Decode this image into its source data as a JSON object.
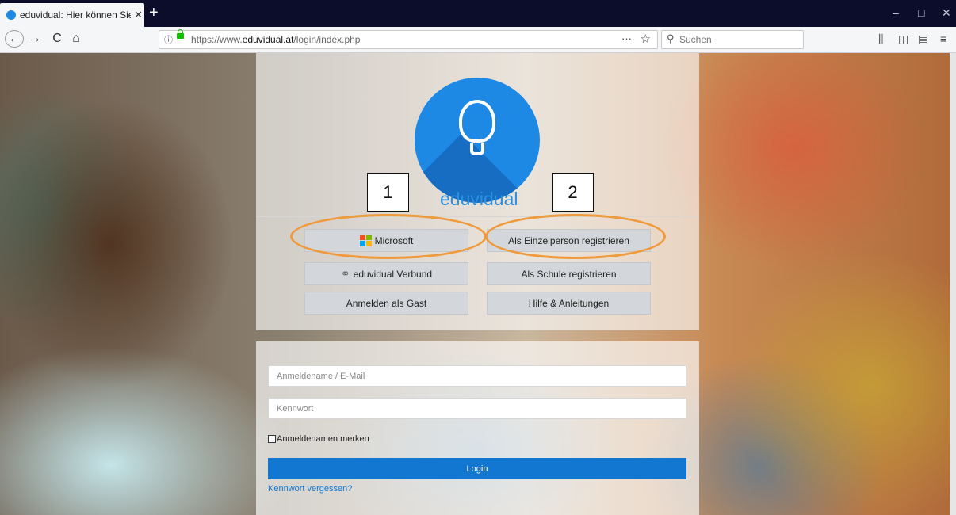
{
  "browser": {
    "tab_title": "eduvidual: Hier können Sie sich",
    "tab_close": "✕",
    "new_tab": "+",
    "window_controls": [
      "–",
      "□",
      "✕"
    ],
    "url_info": "ⓘ",
    "url_prefix": "https://www.",
    "url_domain": "eduvidual.at",
    "url_path": "/login/index.php",
    "page_actions": "···",
    "bookmark_star": "☆",
    "search_placeholder": "Suchen"
  },
  "logo": {
    "brand": "eduvidual"
  },
  "buttons": {
    "microsoft": "Microsoft",
    "verbund": "eduvidual Verbund",
    "guest": "Anmelden als Gast",
    "register_person": "Als Einzelperson registrieren",
    "register_school": "Als Schule registrieren",
    "help": "Hilfe & Anleitungen"
  },
  "form": {
    "username_placeholder": "Anmeldename / E-Mail",
    "password_placeholder": "Kennwort",
    "remember": "Anmeldenamen merken",
    "login": "Login",
    "forgot": "Kennwort vergessen?"
  },
  "annotations": {
    "box1": "1",
    "box2": "2"
  },
  "colors": {
    "accent": "#1177d1",
    "annotation": "#ef9a3c",
    "logo": "#1e88e5"
  }
}
